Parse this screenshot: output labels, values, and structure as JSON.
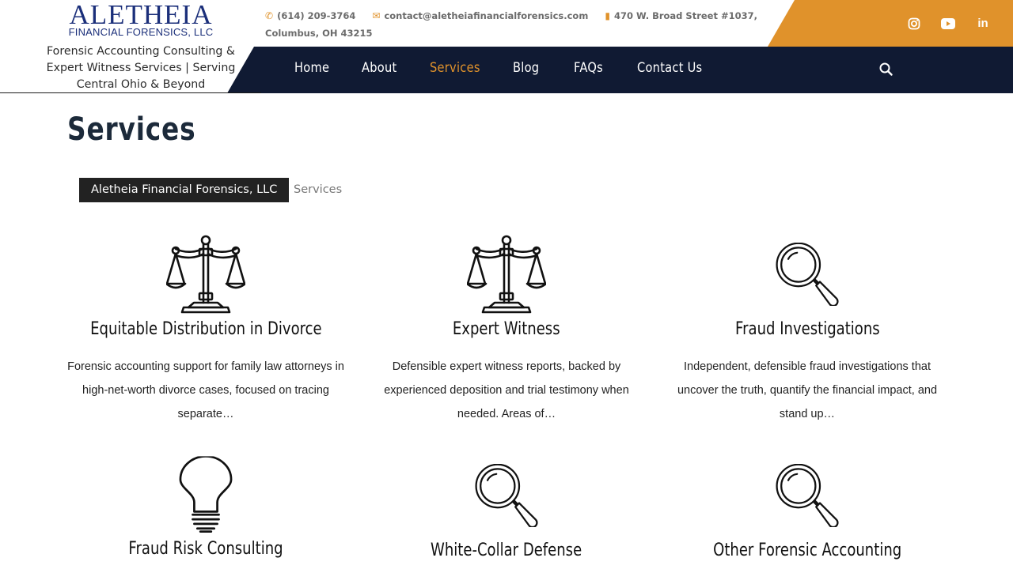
{
  "brand": {
    "logo_main": "ALETHEIA",
    "logo_sub": "FINANCIAL FORENSICS, LLC",
    "tagline": "Forensic Accounting Consulting & Expert Witness Services | Serving Central Ohio & Beyond"
  },
  "topbar": {
    "phone": "(614) 209-3764",
    "email": "contact@aletheiafinancialforensics.com",
    "address_line1": "470 W. Broad Street #1037,",
    "address_line2": "Columbus, OH 43215",
    "accent_color": "#e0922b"
  },
  "social": [
    {
      "icon": "instagram-icon"
    },
    {
      "icon": "youtube-icon"
    },
    {
      "icon": "linkedin-icon",
      "label": "in"
    }
  ],
  "nav": {
    "items": [
      {
        "label": "Home"
      },
      {
        "label": "About"
      },
      {
        "label": "Services",
        "active": true
      },
      {
        "label": "Blog"
      },
      {
        "label": "FAQs"
      },
      {
        "label": "Contact Us"
      }
    ],
    "background": "#101a33"
  },
  "page": {
    "title": "Services",
    "breadcrumb": {
      "home": "Aletheia Financial Forensics, LLC",
      "current": "Services"
    }
  },
  "services": [
    {
      "title": "Equitable Distribution in Divorce",
      "icon": "scales-icon",
      "desc": "Forensic accounting support for family law attorneys in high-net-worth divorce cases, focused on tracing separate…"
    },
    {
      "title": "Expert Witness",
      "icon": "scales-icon",
      "desc": "Defensible expert witness reports, backed by experienced deposition and trial testimony when needed. Areas of…"
    },
    {
      "title": "Fraud Investigations",
      "icon": "magnifier-icon",
      "desc": "Independent, defensible fraud investigations that uncover the truth, quantify the financial impact, and stand up…"
    },
    {
      "title": "Fraud Risk Consulting",
      "icon": "lightbulb-icon"
    },
    {
      "title": "White-Collar Defense",
      "icon": "magnifier-icon"
    },
    {
      "title": "Other Forensic Accounting",
      "icon": "magnifier-icon"
    }
  ]
}
